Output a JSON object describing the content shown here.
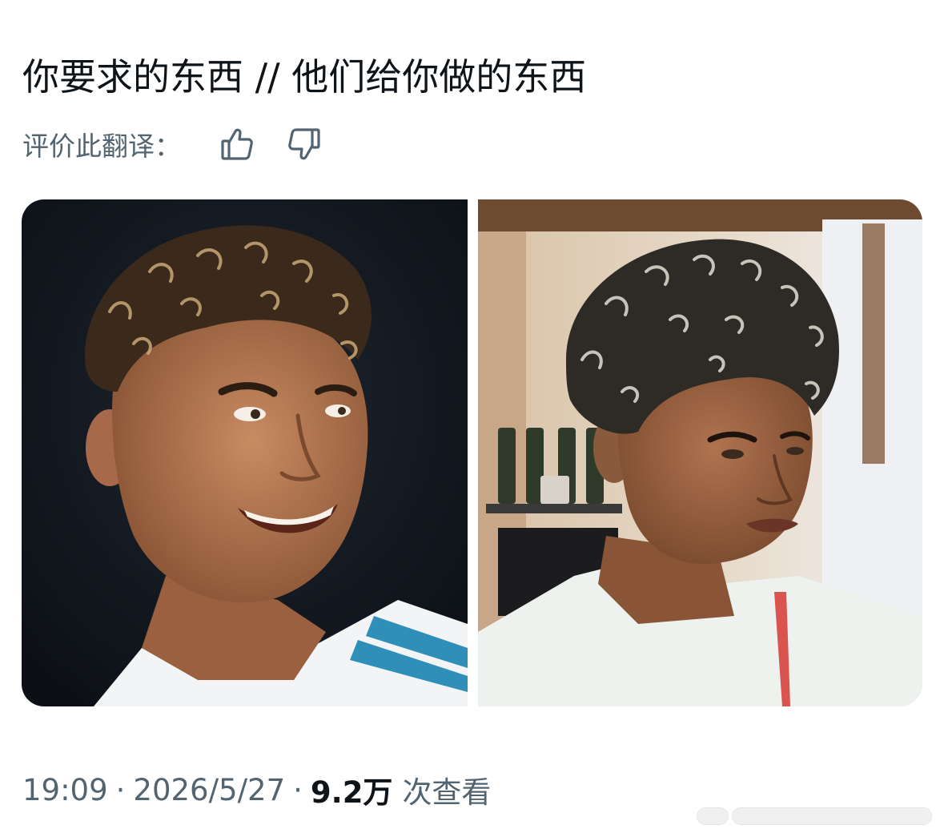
{
  "post": {
    "text": "你要求的东西 // 他们给你做的东西"
  },
  "translation_rating": {
    "label": "评价此翻译：",
    "thumbs_up_icon": "thumbs-up-icon",
    "thumbs_down_icon": "thumbs-down-icon"
  },
  "media": {
    "left_image": "photo-curly-hair-soccer-player",
    "right_image": "photo-curly-hair-barbershop"
  },
  "meta": {
    "time": "19:09",
    "separator": "·",
    "date": "2026/5/27",
    "views_count": "9.2万",
    "views_label": "次查看"
  },
  "colors": {
    "text_primary": "#0f1419",
    "text_secondary": "#536471",
    "background": "#ffffff"
  }
}
